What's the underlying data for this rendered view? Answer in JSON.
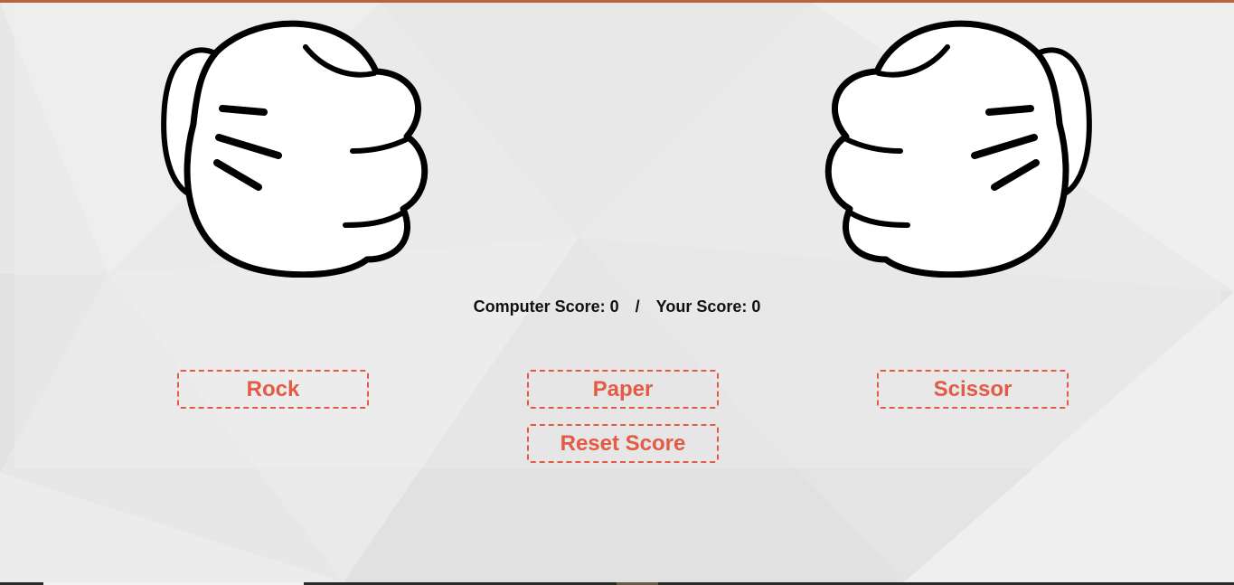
{
  "colors": {
    "accent": "#e35a45",
    "top_strip": "#b8643c",
    "background": "#e7e7e7",
    "text": "#111111"
  },
  "computer_hand": {
    "icon": "fist-icon",
    "choice_shown": "rock"
  },
  "player_hand": {
    "icon": "fist-icon",
    "choice_shown": "rock"
  },
  "score": {
    "computer_label": "Computer Score:",
    "computer_value": "0",
    "separator": "/",
    "player_label": "Your Score:",
    "player_value": "0"
  },
  "buttons": {
    "rock": "Rock",
    "paper": "Paper",
    "scissor": "Scissor",
    "reset": "Reset Score"
  }
}
